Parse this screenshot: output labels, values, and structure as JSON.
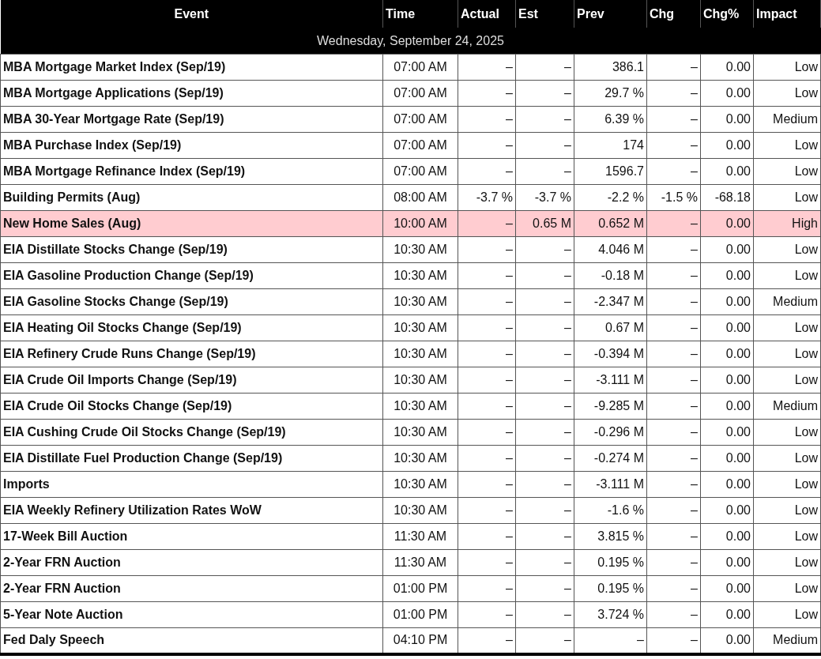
{
  "table": {
    "columns": [
      "Event",
      "Time",
      "Actual",
      "Est",
      "Prev",
      "Chg",
      "Chg%",
      "Impact"
    ],
    "date_header": "Wednesday, September 24, 2025",
    "rows": [
      {
        "highlighted": false,
        "cells": [
          "MBA Mortgage Market Index (Sep/19)",
          "07:00 AM",
          "–",
          "–",
          "386.1",
          "–",
          "0.00",
          "Low"
        ]
      },
      {
        "highlighted": false,
        "cells": [
          "MBA Mortgage Applications (Sep/19)",
          "07:00 AM",
          "–",
          "–",
          "29.7 %",
          "–",
          "0.00",
          "Low"
        ]
      },
      {
        "highlighted": false,
        "cells": [
          "MBA 30-Year Mortgage Rate (Sep/19)",
          "07:00 AM",
          "–",
          "–",
          "6.39 %",
          "–",
          "0.00",
          "Medium"
        ]
      },
      {
        "highlighted": false,
        "cells": [
          "MBA Purchase Index (Sep/19)",
          "07:00 AM",
          "–",
          "–",
          "174",
          "–",
          "0.00",
          "Low"
        ]
      },
      {
        "highlighted": false,
        "cells": [
          "MBA Mortgage Refinance Index (Sep/19)",
          "07:00 AM",
          "–",
          "–",
          "1596.7",
          "–",
          "0.00",
          "Low"
        ]
      },
      {
        "highlighted": false,
        "cells": [
          "Building Permits (Aug)",
          "08:00 AM",
          "-3.7 %",
          "-3.7 %",
          "-2.2 %",
          "-1.5 %",
          "-68.18",
          "Low"
        ]
      },
      {
        "highlighted": true,
        "cells": [
          "New Home Sales (Aug)",
          "10:00 AM",
          "–",
          "0.65 M",
          "0.652 M",
          "–",
          "0.00",
          "High"
        ]
      },
      {
        "highlighted": false,
        "cells": [
          "EIA Distillate Stocks Change (Sep/19)",
          "10:30 AM",
          "–",
          "–",
          "4.046 M",
          "–",
          "0.00",
          "Low"
        ]
      },
      {
        "highlighted": false,
        "cells": [
          "EIA Gasoline Production Change (Sep/19)",
          "10:30 AM",
          "–",
          "–",
          "-0.18 M",
          "–",
          "0.00",
          "Low"
        ]
      },
      {
        "highlighted": false,
        "cells": [
          "EIA Gasoline Stocks Change (Sep/19)",
          "10:30 AM",
          "–",
          "–",
          "-2.347 M",
          "–",
          "0.00",
          "Medium"
        ]
      },
      {
        "highlighted": false,
        "cells": [
          "EIA Heating Oil Stocks Change (Sep/19)",
          "10:30 AM",
          "–",
          "–",
          "0.67 M",
          "–",
          "0.00",
          "Low"
        ]
      },
      {
        "highlighted": false,
        "cells": [
          "EIA Refinery Crude Runs Change (Sep/19)",
          "10:30 AM",
          "–",
          "–",
          "-0.394 M",
          "–",
          "0.00",
          "Low"
        ]
      },
      {
        "highlighted": false,
        "cells": [
          "EIA Crude Oil Imports Change (Sep/19)",
          "10:30 AM",
          "–",
          "–",
          "-3.111 M",
          "–",
          "0.00",
          "Low"
        ]
      },
      {
        "highlighted": false,
        "cells": [
          "EIA Crude Oil Stocks Change (Sep/19)",
          "10:30 AM",
          "–",
          "–",
          "-9.285 M",
          "–",
          "0.00",
          "Medium"
        ]
      },
      {
        "highlighted": false,
        "cells": [
          "EIA Cushing Crude Oil Stocks Change (Sep/19)",
          "10:30 AM",
          "–",
          "–",
          "-0.296 M",
          "–",
          "0.00",
          "Low"
        ]
      },
      {
        "highlighted": false,
        "cells": [
          "EIA Distillate Fuel Production Change (Sep/19)",
          "10:30 AM",
          "–",
          "–",
          "-0.274 M",
          "–",
          "0.00",
          "Low"
        ]
      },
      {
        "highlighted": false,
        "cells": [
          "Imports",
          "10:30 AM",
          "–",
          "–",
          "-3.111 M",
          "–",
          "0.00",
          "Low"
        ]
      },
      {
        "highlighted": false,
        "cells": [
          "EIA Weekly Refinery Utilization Rates WoW",
          "10:30 AM",
          "–",
          "–",
          "-1.6 %",
          "–",
          "0.00",
          "Low"
        ]
      },
      {
        "highlighted": false,
        "cells": [
          "17-Week Bill Auction",
          "11:30 AM",
          "–",
          "–",
          "3.815 %",
          "–",
          "0.00",
          "Low"
        ]
      },
      {
        "highlighted": false,
        "cells": [
          "2-Year FRN Auction",
          "11:30 AM",
          "–",
          "–",
          "0.195 %",
          "–",
          "0.00",
          "Low"
        ]
      },
      {
        "highlighted": false,
        "cells": [
          "2-Year FRN Auction",
          "01:00 PM",
          "–",
          "–",
          "0.195 %",
          "–",
          "0.00",
          "Low"
        ]
      },
      {
        "highlighted": false,
        "cells": [
          "5-Year Note Auction",
          "01:00 PM",
          "–",
          "–",
          "3.724 %",
          "–",
          "0.00",
          "Low"
        ]
      },
      {
        "highlighted": false,
        "cells": [
          "Fed Daly Speech",
          "04:10 PM",
          "–",
          "–",
          "–",
          "–",
          "0.00",
          "Medium"
        ]
      }
    ]
  }
}
